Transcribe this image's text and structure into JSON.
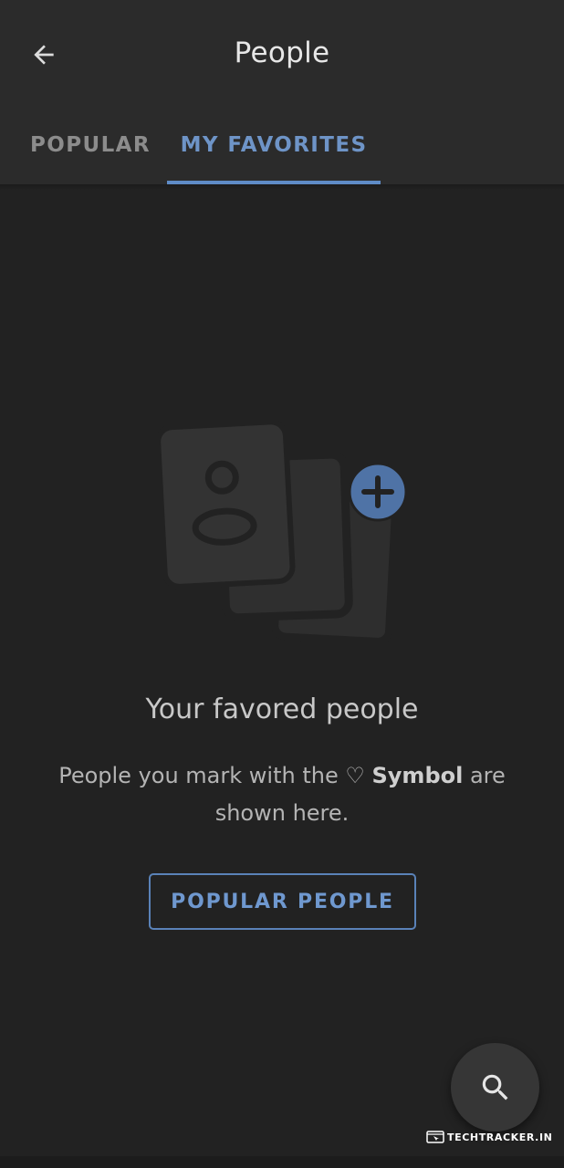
{
  "header": {
    "title": "People",
    "back_icon": "arrow-left-icon"
  },
  "tabs": [
    {
      "label": "POPULAR",
      "active": false
    },
    {
      "label": "MY FAVORITES",
      "active": true
    }
  ],
  "empty_state": {
    "illustration_icon": "contact-cards-add-icon",
    "title": "Your favored people",
    "desc_before": "People you mark with the ",
    "heart_symbol": "♡",
    "desc_bold": "Symbol",
    "desc_after": " are shown here.",
    "button_label": "POPULAR PEOPLE"
  },
  "fab": {
    "icon": "search-icon"
  },
  "watermark": {
    "text": "TECHTRACKER.IN"
  },
  "colors": {
    "background": "#222222",
    "header": "#2b2b2b",
    "accent": "#5f8cc7",
    "inactive_tab": "#8c8c8c",
    "fab": "#363636"
  }
}
